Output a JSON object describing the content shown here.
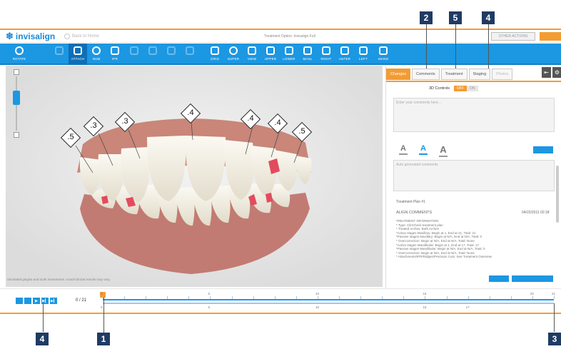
{
  "header": {
    "logo_text": "invisalign",
    "back_link": "Back to Home",
    "treatment_option": "Treatment Option: Invisalign Full",
    "other_actions": "OTHER ACTIONS"
  },
  "toolbar": {
    "items": [
      {
        "label": "ROTATE",
        "icon": "rotate-icon",
        "state": "normal"
      },
      {
        "label": "",
        "icon": "pan-icon",
        "state": "dim"
      },
      {
        "label": "ATTACH",
        "icon": "attach-icon",
        "state": "active"
      },
      {
        "label": "NUM",
        "icon": "num-icon",
        "state": "normal"
      },
      {
        "label": "IPR",
        "icon": "ipr-icon",
        "state": "normal"
      },
      {
        "label": "",
        "icon": "tool-icon",
        "state": "dim"
      },
      {
        "label": "",
        "icon": "tool-icon",
        "state": "dim"
      },
      {
        "label": "",
        "icon": "tool-icon",
        "state": "dim"
      },
      {
        "label": "",
        "icon": "tool-icon",
        "state": "dim"
      },
      {
        "label": "GRID",
        "icon": "grid-icon",
        "state": "normal"
      },
      {
        "label": "SUPER",
        "icon": "super-icon",
        "state": "normal"
      },
      {
        "label": "VIEW",
        "icon": "view-icon",
        "state": "normal"
      },
      {
        "label": "UPPER",
        "icon": "upper-icon",
        "state": "normal"
      },
      {
        "label": "LOWER",
        "icon": "lower-icon",
        "state": "normal"
      },
      {
        "label": "MAXL",
        "icon": "maxl-icon",
        "state": "normal"
      },
      {
        "label": "RIGHT",
        "icon": "right-icon",
        "state": "normal"
      },
      {
        "label": "ANTER",
        "icon": "anter-icon",
        "state": "normal"
      },
      {
        "label": "LEFT",
        "icon": "left-icon",
        "state": "normal"
      },
      {
        "label": "MAND",
        "icon": "mand-icon",
        "state": "normal"
      }
    ]
  },
  "viewport": {
    "tooth_labels": [
      ".5",
      ".3",
      ".3",
      ".4",
      ".4",
      ".4",
      ".5"
    ],
    "disclaimer": "Simulated gingiva and tooth movements. Actual clinical results may vary.",
    "gum_color": "#c4827a",
    "tooth_color": "#f3f0e6",
    "attachment_color": "#e34b5e"
  },
  "panel": {
    "tabs": [
      {
        "label": "Changes",
        "state": "active"
      },
      {
        "label": "Comments",
        "state": "normal"
      },
      {
        "label": "Treatment",
        "state": "normal"
      },
      {
        "label": "Staging",
        "state": "normal"
      },
      {
        "label": "Photos",
        "state": "disabled"
      }
    ],
    "controls_label": "3D Controls",
    "toggle_off": "OFF",
    "toggle_on": "ON",
    "comment_placeholder": "Enter your comments here...",
    "font_sizes": [
      "A",
      "A",
      "A"
    ],
    "auto_placeholder": "Auto generated comments",
    "treatment_plan": "Treatment Plan #1",
    "align_comments": "ALIGN COMMENTS",
    "align_date": "04/22/2011 02:18",
    "treatment_info": [
      "TREATMENT INFORMATION",
      "* Type: ClinCheck treatment plan",
      "* Treated Arches: Both Arches",
      "*Active stages Maxillary: Begin at 1, End at 21, Total: 21",
      "*Passive stages Maxillary: Begin at N/A, End at N/A, Total: 0",
      "* Overcorrection: Begin at N/A, End at N/A, Total: None",
      "*Active stages Mandibular: Begin at 1, End at 17, Total: 17",
      "*Passive stages Mandibular: Begin at N/A, End at N/A, Total: 0",
      "* Overcorrection: Begin at N/A, End at N/A, Total: None",
      "* Attachments/IPR/Ridges/Precision Cuts: See Treatment Overview"
    ]
  },
  "timeline": {
    "stage_readout": "0 / 21",
    "upper_numbers": [
      "0",
      "5",
      "10",
      "15",
      "20",
      "21"
    ],
    "lower_numbers": [
      "0",
      "5",
      "10",
      "15",
      "17"
    ]
  },
  "callouts": [
    "2",
    "5",
    "4",
    "4",
    "1",
    "3"
  ]
}
